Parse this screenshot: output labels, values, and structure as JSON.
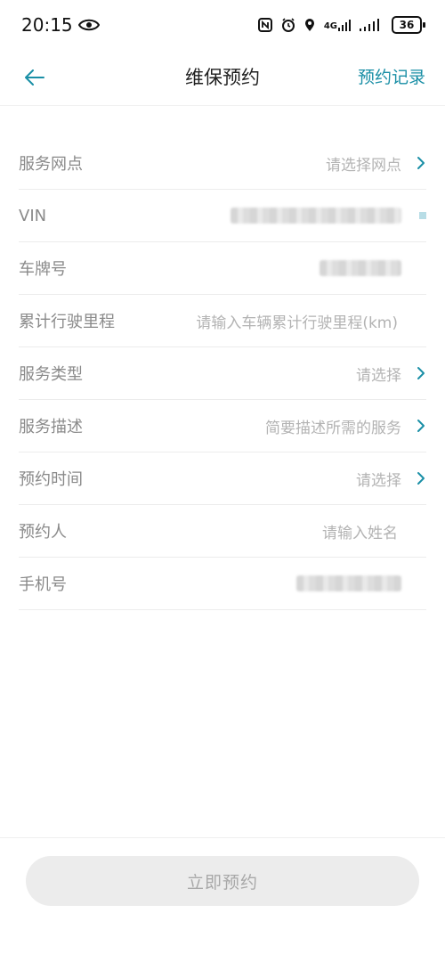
{
  "status_bar": {
    "time": "20:15",
    "network": "4G",
    "battery": "36"
  },
  "header": {
    "title": "维保预约",
    "records_link": "预约记录"
  },
  "form": {
    "rows": [
      {
        "label": "服务网点",
        "value": "请选择网点",
        "has_chevron": true
      },
      {
        "label": "VIN",
        "value": "",
        "blurred": true
      },
      {
        "label": "车牌号",
        "value": "",
        "blurred": true
      },
      {
        "label": "累计行驶里程",
        "value": "请输入车辆累计行驶里程(km)",
        "has_chevron": false
      },
      {
        "label": "服务类型",
        "value": "请选择",
        "has_chevron": true
      },
      {
        "label": "服务描述",
        "value": "简要描述所需的服务",
        "has_chevron": true
      },
      {
        "label": "预约时间",
        "value": "请选择",
        "has_chevron": true
      },
      {
        "label": "预约人",
        "value": "请输入姓名",
        "has_chevron": false
      },
      {
        "label": "手机号",
        "value": "",
        "blurred": true
      }
    ]
  },
  "submit": {
    "label": "立即预约"
  },
  "colors": {
    "accent": "#1a8fa6",
    "label": "#8a8a8a",
    "placeholder": "#b3b3b3",
    "button_bg": "#ececec"
  }
}
